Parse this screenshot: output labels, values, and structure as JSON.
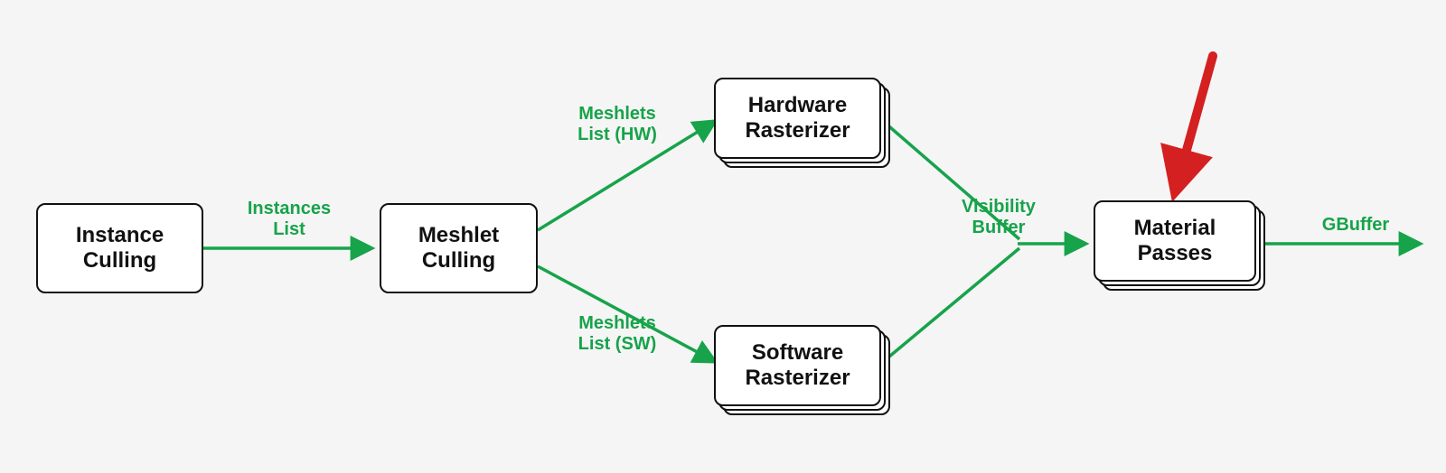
{
  "nodes": {
    "instance_culling": "Instance\nCulling",
    "meshlet_culling": "Meshlet\nCulling",
    "hardware_rasterizer": "Hardware\nRasterizer",
    "software_rasterizer": "Software\nRasterizer",
    "material_passes": "Material\nPasses"
  },
  "edges": {
    "instances_list": "Instances\nList",
    "meshlets_hw": "Meshlets\nList (HW)",
    "meshlets_sw": "Meshlets\nList (SW)",
    "visibility_buffer": "Visibility\nBuffer",
    "gbuffer": "GBuffer"
  },
  "colors": {
    "edge": "#17a34a",
    "node_border": "#111111",
    "node_bg": "#ffffff",
    "annotation": "#d42020",
    "canvas_bg": "#f5f5f5"
  }
}
